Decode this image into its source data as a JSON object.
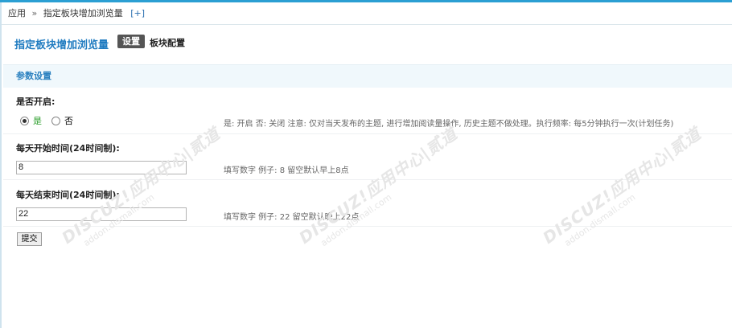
{
  "breadcrumb": {
    "root": "应用",
    "separator": "»",
    "current": "指定板块增加浏览量",
    "add": "[+]"
  },
  "header": {
    "title": "指定板块增加浏览量",
    "tab_settings": "设置",
    "tab_blocks": "板块配置"
  },
  "section": {
    "title": "参数设置"
  },
  "enable": {
    "label": "是否开启:",
    "option_yes": "是",
    "option_no": "否",
    "selected": "是",
    "tip": "是: 开启 否: 关闭 注意: 仅对当天发布的主题, 进行增加阅读量操作, 历史主题不做处理。执行频率: 每5分钟执行一次(计划任务)"
  },
  "start_time": {
    "label": "每天开始时间(24时间制):",
    "value": "8",
    "tip": "填写数字   例子: 8   留空默认早上8点"
  },
  "end_time": {
    "label": "每天结束时间(24时间制):",
    "value": "22",
    "tip": "填写数字   例子: 22   留空默认晚上22点"
  },
  "submit": {
    "label": "提交"
  },
  "watermark": {
    "brand": "DISCUZ!应用中心|贰道",
    "url": "addon.dismall.com"
  }
}
